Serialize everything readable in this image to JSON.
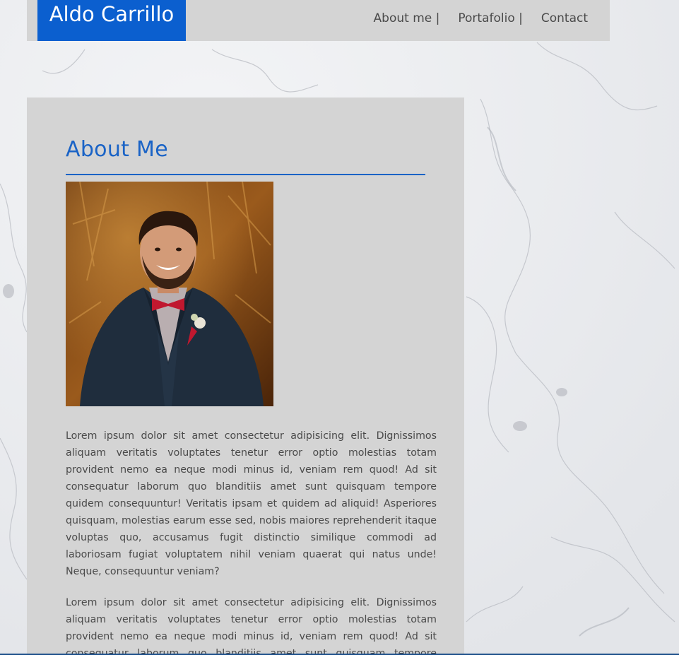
{
  "header": {
    "logo_text": "Aldo Carrillo",
    "nav": [
      {
        "label": "About me |"
      },
      {
        "label": "Portafolio |"
      },
      {
        "label": "Contact"
      }
    ]
  },
  "about": {
    "title": "About Me",
    "paragraphs": [
      "Lorem ipsum dolor sit amet consectetur adipisicing elit. Dignissimos aliquam veritatis voluptates tenetur error optio molestias totam provident nemo ea neque modi minus id, veniam rem quod! Ad sit consequatur laborum quo blanditiis amet sunt quisquam tempore quidem consequuntur! Veritatis ipsam et quidem ad aliquid! Asperiores quisquam, molestias earum esse sed, nobis maiores reprehenderit itaque voluptas quo, accusamus fugit distinctio similique commodi ad laboriosam fugiat voluptatem nihil veniam quaerat qui natus unde! Neque, consequuntur veniam?",
      "Lorem ipsum dolor sit amet consectetur adipisicing elit. Dignissimos aliquam veritatis voluptates tenetur error optio molestias totam provident nemo ea neque modi minus id, veniam rem quod! Ad sit consequatur laborum quo blanditiis amet sunt quisquam tempore quidem"
    ]
  },
  "colors": {
    "brand_blue": "#0b5fcf",
    "header_bg": "#d4d4d4",
    "card_bg": "#d4d4d4",
    "heading_blue": "#1a63c6",
    "body_text": "#4a4a4a"
  }
}
